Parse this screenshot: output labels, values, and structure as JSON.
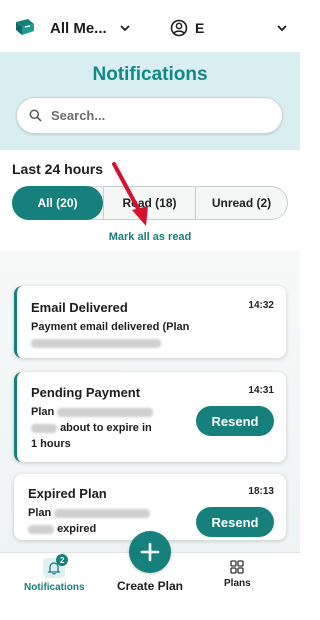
{
  "topbar": {
    "member_select": "All Me...",
    "user_initial": "E"
  },
  "header": {
    "title": "Notifications",
    "search_placeholder": "Search..."
  },
  "section_label": "Last 24 hours",
  "tabs": [
    {
      "label": "All (20)",
      "active": true
    },
    {
      "label": "Read (18)",
      "active": false
    },
    {
      "label": "Unread (2)",
      "active": false
    }
  ],
  "mark_all_label": "Mark all as read",
  "notifications": [
    {
      "title": "Email Delivered",
      "time": "14:32",
      "text": "Payment email delivered (Plan"
    },
    {
      "title": "Pending Payment",
      "time": "14:31",
      "text_before": "Plan",
      "text_after": "about to expire in",
      "text_end": "1 hours",
      "action": "Resend"
    },
    {
      "title": "Expired Plan",
      "time": "18:13",
      "text_before": "Plan",
      "text_after": "expired",
      "action": "Resend"
    }
  ],
  "bottom_nav": {
    "notifications_label": "Notifications",
    "notifications_badge": "2",
    "create_label": "Create Plan",
    "plans_label": "Plans"
  },
  "colors": {
    "accent": "#16807c",
    "header_bg": "#d9eef0",
    "annotation_arrow": "#d8102f"
  }
}
